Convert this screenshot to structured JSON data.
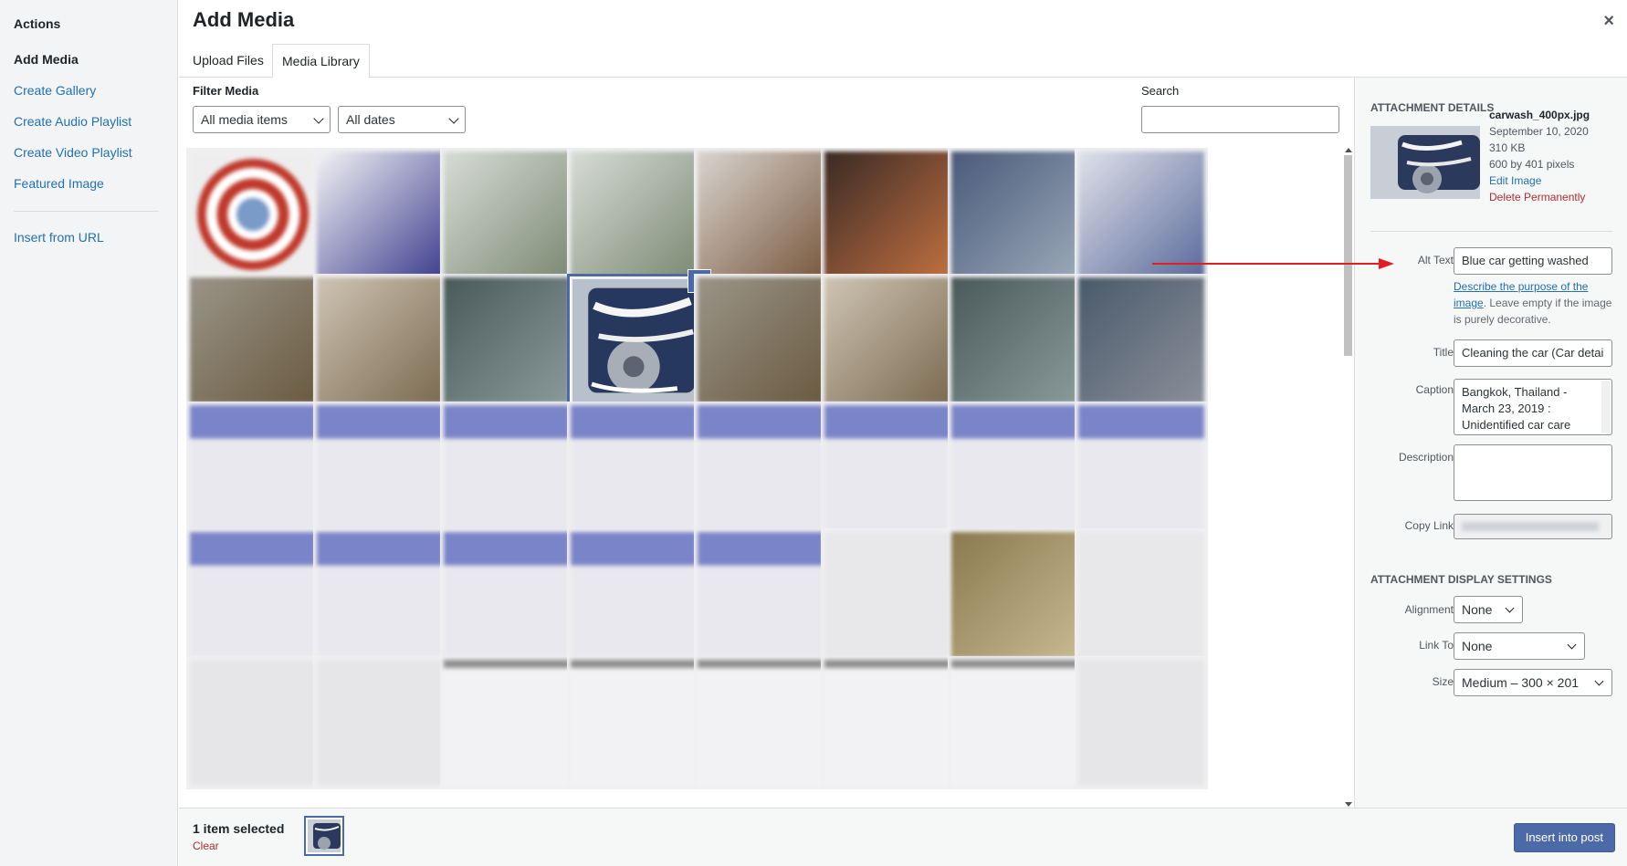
{
  "sidebar": {
    "heading": "Actions",
    "items": [
      {
        "label": "Add Media"
      },
      {
        "label": "Create Gallery"
      },
      {
        "label": "Create Audio Playlist"
      },
      {
        "label": "Create Video Playlist"
      },
      {
        "label": "Featured Image"
      },
      {
        "label": "Insert from URL"
      }
    ]
  },
  "modal": {
    "title": "Add Media",
    "close_glyph": "×"
  },
  "tabs": [
    {
      "label": "Upload Files"
    },
    {
      "label": "Media Library"
    }
  ],
  "filter": {
    "label": "Filter Media",
    "type_value": "All media items",
    "date_value": "All dates",
    "search_label": "Search",
    "search_value": ""
  },
  "grid": {
    "selected_index": 11,
    "check_glyph": "✓"
  },
  "details": {
    "heading": "Attachment Details",
    "filename": "carwash_400px.jpg",
    "date": "September 10, 2020",
    "filesize": "310 KB",
    "dimensions": "600 by 401 pixels",
    "edit_link": "Edit Image",
    "delete_link": "Delete Permanently",
    "alt_label": "Alt Text",
    "alt_value": "Blue car getting washed",
    "help_link": "Describe the purpose of the image",
    "help_rest": ". Leave empty if the image is purely decorative.",
    "title_label": "Title",
    "title_value": "Cleaning the car (Car detai",
    "caption_label": "Caption",
    "caption_value": "Bangkok, Thailand - March 23, 2019 : Unidentified car care",
    "description_label": "Description",
    "description_value": "",
    "copy_link_label": "Copy Link",
    "display_heading": "Attachment Display Settings",
    "alignment_label": "Alignment",
    "alignment_value": "None",
    "link_to_label": "Link To",
    "link_to_value": "None",
    "size_label": "Size",
    "size_value": "Medium – 300 × 201"
  },
  "footer": {
    "count": "1 item selected",
    "clear": "Clear",
    "insert": "Insert into post"
  },
  "colors": {
    "accent": "#4d6aa8",
    "link": "#2271b1",
    "danger": "#b32d2e",
    "annotation_arrow": "#e02020"
  }
}
